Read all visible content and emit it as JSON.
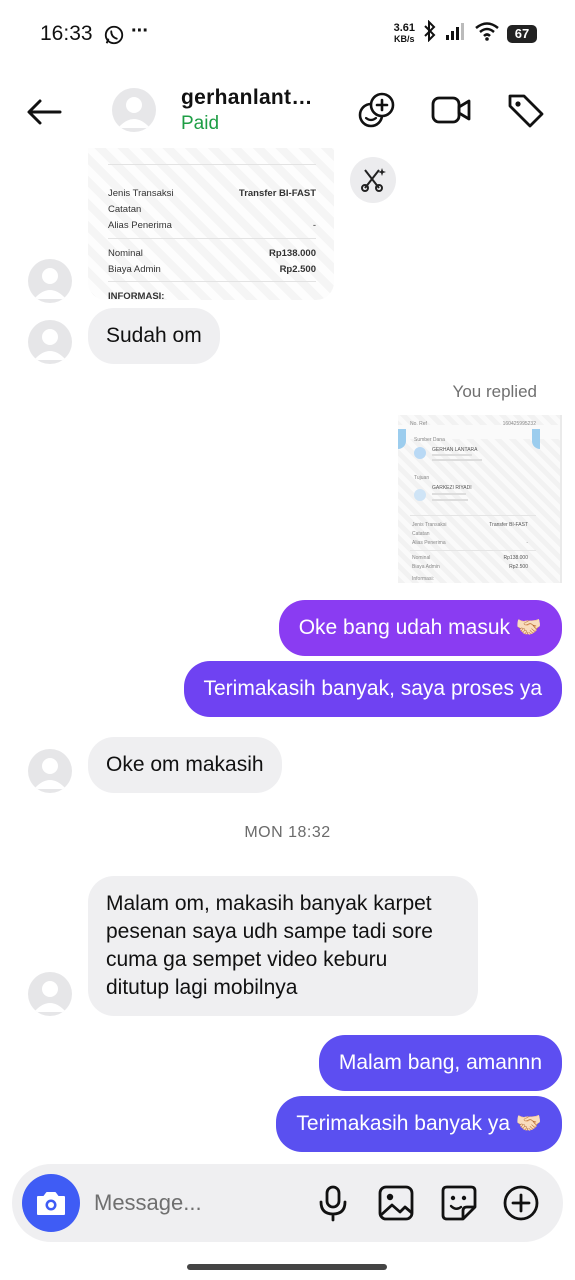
{
  "status_bar": {
    "time": "16:33",
    "net_speed_value": "3.61",
    "net_speed_unit": "KB/s",
    "battery": "67",
    "more": "···"
  },
  "header": {
    "contact_name": "gerhanlant…",
    "contact_status": "Paid"
  },
  "receipt_top": {
    "rows": [
      {
        "label": "Jenis Transaksi",
        "value": "Transfer BI-FAST"
      },
      {
        "label": "Catatan",
        "value": ""
      },
      {
        "label": "Alias Penerima",
        "value": "-"
      },
      {
        "label": "Nominal",
        "value": "Rp138.000"
      },
      {
        "label": "Biaya Admin",
        "value": "Rp2.500"
      }
    ],
    "footer_label": "INFORMASI:"
  },
  "receipt_replied": {
    "ref_label": "No. Ref",
    "ref_value": "160425995232",
    "source_label": "Sumber Dana",
    "source_name": "GERHAN LANTARA",
    "dest_label": "Tujuan",
    "dest_name": "GARKEZI RIYADI",
    "type_label": "Jenis Transaksi",
    "type_value": "Transfer BI-FAST",
    "note_label": "Catatan",
    "alias_label": "Alias Penerima",
    "alias_value": "-",
    "nominal_label": "Nominal",
    "nominal_value": "Rp138.000",
    "fee_label": "Biaya Admin",
    "fee_value": "Rp2.500",
    "info_label": "Informasi:"
  },
  "messages": {
    "in_1": "Sudah om",
    "replied_label": "You replied",
    "out_1": "Oke bang udah masuk 🤝🏻",
    "out_2": "Terimakasih banyak, saya proses ya",
    "in_2": "Oke om makasih",
    "timestamp": "MON 18:32",
    "in_3_lines": [
      "Malam om, makasih banyak karpet",
      "pesenan saya udh sampe tadi sore",
      "cuma ga sempet video keburu",
      "ditutup lagi mobilnya"
    ],
    "out_3": "Malam bang, amannn",
    "out_4": "Terimakasih banyak ya 🤝🏻"
  },
  "composer": {
    "placeholder": "Message..."
  },
  "colors": {
    "bubble_purple": "#8a3cf2",
    "bubble_violet": "#6845f2",
    "bubble_indigo": "#5a4ff0",
    "incoming_bg": "#efeff1",
    "paid_green": "#1e9e45",
    "camera_blue": "#3f5cf5"
  },
  "icons": [
    "whatsapp-icon",
    "bluetooth-icon",
    "signal-icon",
    "wifi-icon",
    "back-arrow-icon",
    "add-to-group-icon",
    "video-call-icon",
    "tag-icon",
    "ai-sparkle-icon",
    "camera-icon",
    "microphone-icon",
    "gallery-icon",
    "sticker-icon",
    "plus-circle-icon"
  ]
}
